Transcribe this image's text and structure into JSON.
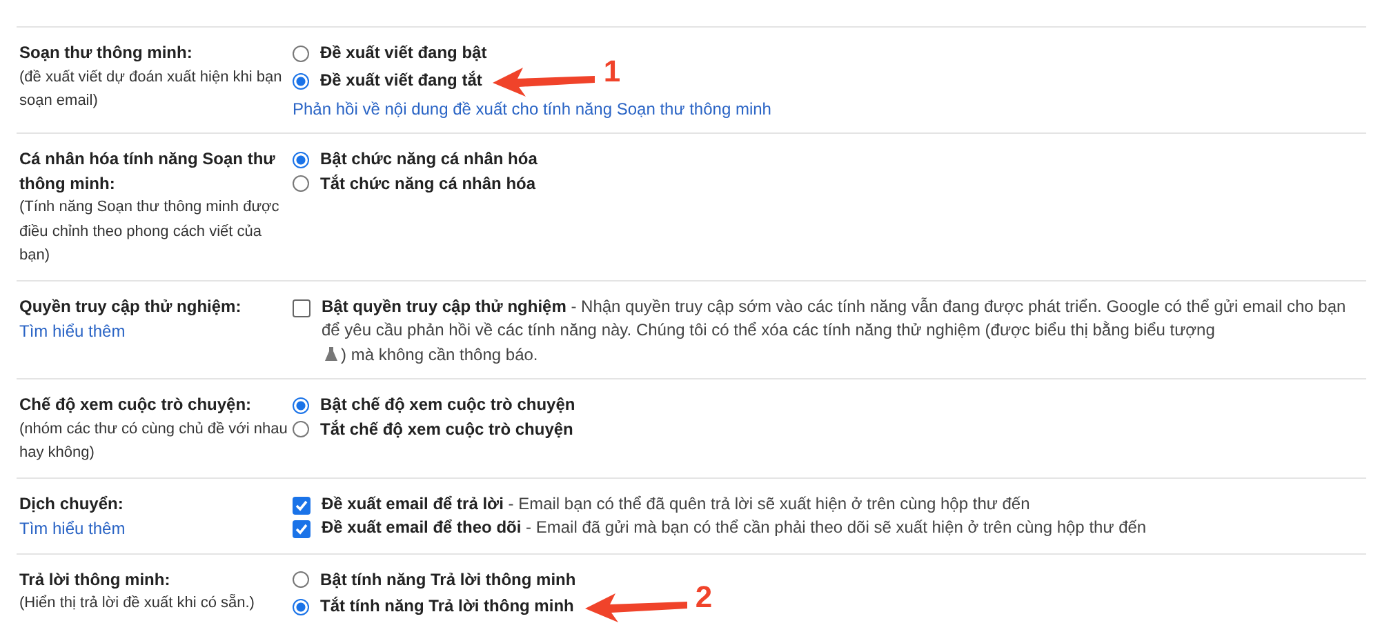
{
  "settings": [
    {
      "label": "Soạn thư thông minh:",
      "hint": "(đề xuất viết dự đoán xuất hiện khi bạn soạn email)",
      "kind": "radio",
      "options": [
        {
          "text": "Đề xuất viết đang bật",
          "selected": false
        },
        {
          "text": "Đề xuất viết đang tắt",
          "selected": true,
          "annotation": "1"
        }
      ],
      "link": "Phản hồi về nội dung đề xuất cho tính năng Soạn thư thông minh"
    },
    {
      "label": "Cá nhân hóa tính năng Soạn thư thông minh:",
      "hint": "(Tính năng Soạn thư thông minh được điều chỉnh theo phong cách viết của bạn)",
      "kind": "radio",
      "options": [
        {
          "text": "Bật chức năng cá nhân hóa",
          "selected": true
        },
        {
          "text": "Tắt chức năng cá nhân hóa",
          "selected": false
        }
      ]
    },
    {
      "label": "Quyền truy cập thử nghiệm:",
      "label_link": "Tìm hiểu thêm",
      "kind": "checkbox",
      "options": [
        {
          "text": "**Bật quyền truy cập thử nghiệm** - Nhận quyền truy cập sớm vào các tính năng vẫn đang được phát triển. Google có thể gửi email cho bạn để yêu cầu phản hồi về các tính năng này. Chúng tôi có thể xóa các tính năng thử nghiệm (được biểu thị bằng biểu tượng",
          "text_after": ") mà không cần thông báo.",
          "checked": false
        }
      ]
    },
    {
      "label": "Chế độ xem cuộc trò chuyện:",
      "hint": "(nhóm các thư có cùng chủ đề với nhau hay không)",
      "kind": "radio",
      "options": [
        {
          "text": "Bật chế độ xem cuộc trò chuyện",
          "selected": true
        },
        {
          "text": "Tắt chế độ xem cuộc trò chuyện",
          "selected": false
        }
      ]
    },
    {
      "label": "Dịch chuyển:",
      "label_link": "Tìm hiểu thêm",
      "kind": "checkbox",
      "options": [
        {
          "text": "**Đề xuất email để trả lời** - Email bạn có thể đã quên trả lời sẽ xuất hiện ở trên cùng hộp thư đến",
          "checked": true
        },
        {
          "text": "**Đề xuất email để theo dõi** - Email đã gửi mà bạn có thể cần phải theo dõi sẽ xuất hiện ở trên cùng hộp thư đến",
          "checked": true
        }
      ]
    },
    {
      "label": "Trả lời thông minh:",
      "hint": "(Hiển thị trả lời đề xuất khi có sẵn.)",
      "kind": "radio",
      "options": [
        {
          "text": "Bật tính năng Trả lời thông minh",
          "selected": false
        },
        {
          "text": "Tắt tính năng Trả lời thông minh",
          "selected": true,
          "annotation": "2"
        }
      ]
    }
  ]
}
